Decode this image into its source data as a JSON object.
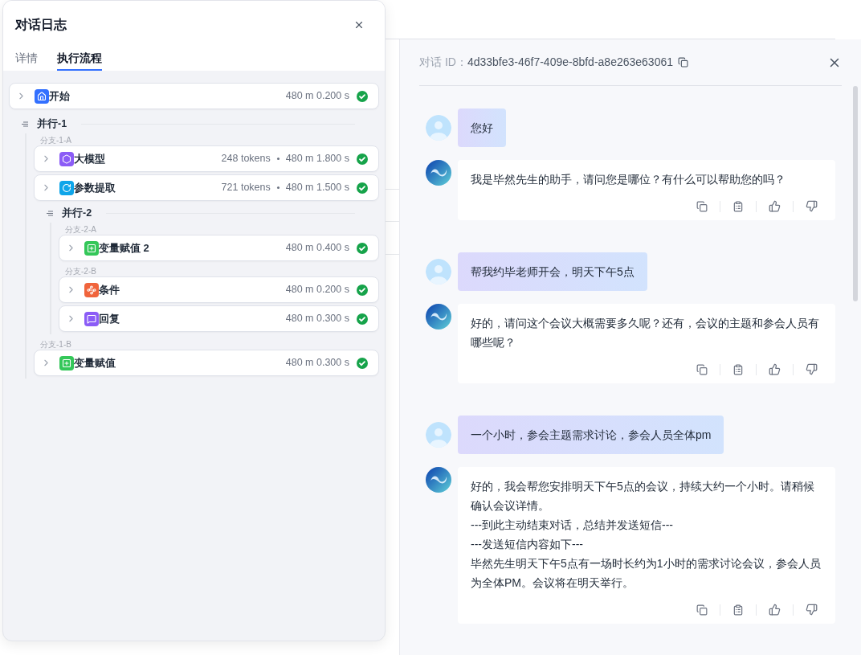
{
  "log_panel": {
    "title": "对话日志",
    "tabs": [
      {
        "label": "详情",
        "selected": false
      },
      {
        "label": "执行流程",
        "selected": true
      }
    ],
    "flow": [
      {
        "kind": "start",
        "color": "#3370ff",
        "name": "开始",
        "stats": "480 m 0.200 s",
        "succeeded": true
      },
      {
        "kind": "parallel",
        "title": "并行-1",
        "branches": [
          {
            "label": "分支-1-A",
            "children": [
              {
                "kind": "llm",
                "color": "#8b5cf6",
                "name": "大模型",
                "tokens": "248 tokens",
                "stats": "480 m 1.800 s",
                "succeeded": true
              },
              {
                "kind": "extract",
                "color": "#0ea5e9",
                "name": "参数提取",
                "tokens": "721 tokens",
                "stats": "480 m 1.500 s",
                "succeeded": true
              },
              {
                "kind": "parallel",
                "title": "并行-2",
                "branches": [
                  {
                    "label": "分支-2-A",
                    "children": [
                      {
                        "kind": "assign",
                        "color": "#34c759",
                        "name": "变量赋值 2",
                        "stats": "480 m 0.400 s",
                        "succeeded": true
                      }
                    ]
                  },
                  {
                    "label": "分支-2-B",
                    "children": [
                      {
                        "kind": "condition",
                        "color": "#f0643c",
                        "name": "条件",
                        "stats": "480 m 0.200 s",
                        "succeeded": true
                      },
                      {
                        "kind": "reply",
                        "color": "#8b5cf6",
                        "name": "回复",
                        "stats": "480 m 0.300 s",
                        "succeeded": true
                      }
                    ]
                  }
                ]
              }
            ]
          },
          {
            "label": "分支-1-B",
            "children": [
              {
                "kind": "assign",
                "color": "#34c759",
                "name": "变量赋值",
                "stats": "480 m 0.300 s",
                "succeeded": true
              }
            ]
          }
        ]
      }
    ]
  },
  "chat_panel": {
    "id_label": "对话 ID：",
    "id_value": "4d33bfe3-46f7-409e-8bfd-a8e263e63061",
    "messages": [
      {
        "kind": "user",
        "paragraphs": [
          "您好"
        ]
      },
      {
        "kind": "assistant",
        "paragraphs": [
          "我是毕然先生的助手，请问您是哪位？有什么可以帮助您的吗？"
        ]
      },
      {
        "kind": "user",
        "paragraphs": [
          "帮我约毕老师开会，明天下午5点"
        ]
      },
      {
        "kind": "assistant",
        "paragraphs": [
          "好的，请问这个会议大概需要多久呢？还有，会议的主题和参会人员有哪些呢？"
        ]
      },
      {
        "kind": "user",
        "paragraphs": [
          "一个小时，参会主题需求讨论，参会人员全体pm"
        ]
      },
      {
        "kind": "assistant",
        "paragraphs": [
          "好的，我会帮您安排明天下午5点的会议，持续大约一个小时。请稍候确认会议详情。",
          "---到此主动结束对话，总结并发送短信---",
          "---发送短信内容如下---",
          "毕然先生明天下午5点有一场时长约为1小时的需求讨论会议，参会人员为全体PM。会议将在明天举行。"
        ]
      }
    ]
  }
}
